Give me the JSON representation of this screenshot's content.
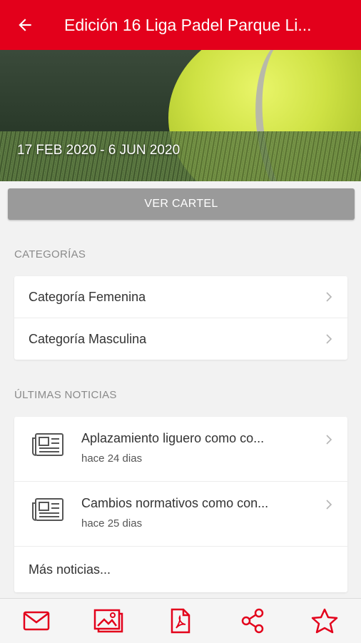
{
  "header": {
    "title": "Edición 16 Liga Padel Parque Li..."
  },
  "hero": {
    "dates": "17 FEB 2020 - 6 JUN 2020"
  },
  "cartel_button": "VER CARTEL",
  "categories": {
    "title": "CATEGORÍAS",
    "items": [
      {
        "label": "Categoría Femenina"
      },
      {
        "label": "Categoría Masculina"
      }
    ]
  },
  "news": {
    "title": "ÚLTIMAS NOTICIAS",
    "items": [
      {
        "title": "Aplazamiento liguero como co...",
        "time": "hace 24 dias"
      },
      {
        "title": "Cambios normativos como con...",
        "time": "hace 25 dias"
      }
    ],
    "more": "Más noticias..."
  },
  "bottom_bar": {
    "icons": [
      "mail-icon",
      "gallery-icon",
      "pdf-icon",
      "share-icon",
      "star-icon"
    ]
  },
  "colors": {
    "primary": "#e3001b",
    "button_gray": "#9a9a9a"
  }
}
